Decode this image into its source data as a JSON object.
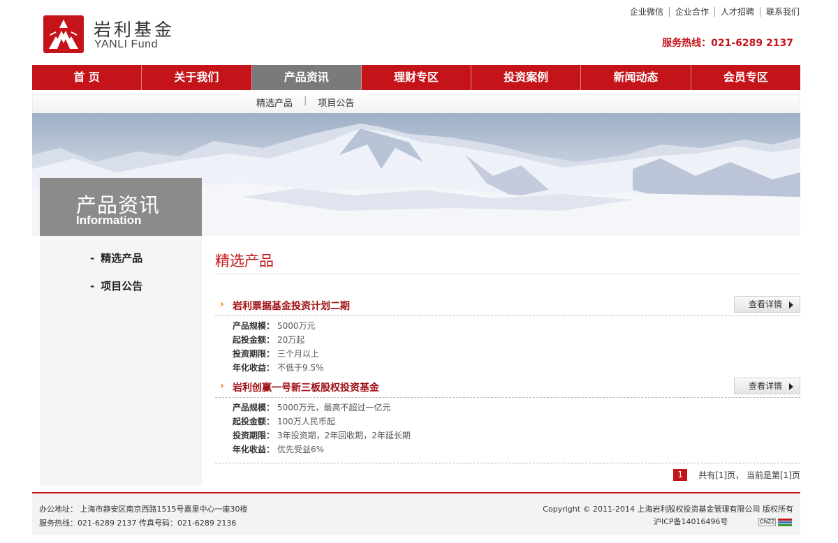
{
  "brand": {
    "name_cn": "岩利基金",
    "name_en": "YANLI Fund",
    "accent_color": "#c4141a"
  },
  "toplinks": [
    "企业微信",
    "企业合作",
    "人才招聘",
    "联系我们"
  ],
  "hotline": "服务热线：021-6289 2137",
  "nav": {
    "items": [
      "首 页",
      "关于我们",
      "产品资讯",
      "理财专区",
      "投资案例",
      "新闻动态",
      "会员专区"
    ],
    "active_index": 2
  },
  "subnav": {
    "items": [
      "精选产品",
      "项目公告"
    ],
    "separator": "|"
  },
  "banner": {
    "title": "产品资讯",
    "subtitle": "Information"
  },
  "sidebar": {
    "items": [
      {
        "dash": "-",
        "label": "精选产品"
      },
      {
        "dash": "-",
        "label": "项目公告"
      }
    ]
  },
  "content": {
    "title": "精选产品",
    "products": [
      {
        "arrow": "›",
        "name": "岩利票据基金投资计划二期",
        "detail_label": "查看详情",
        "specs": [
          {
            "label": "产品规模：",
            "value": "5000万元"
          },
          {
            "label": "起投金额：",
            "value": "20万起"
          },
          {
            "label": "投资期限：",
            "value": "三个月以上"
          },
          {
            "label": "年化收益：",
            "value": "不低于9.5%"
          }
        ]
      },
      {
        "arrow": "›",
        "name": "岩利创赢一号新三板股权投资基金",
        "detail_label": "查看详情",
        "specs": [
          {
            "label": "产品规模：",
            "value": "5000万元，最高不超过一亿元"
          },
          {
            "label": "起投金额：",
            "value": "100万人民币起"
          },
          {
            "label": "投资期限：",
            "value": "3年投资期，2年回收期，2年延长期"
          },
          {
            "label": "年化收益：",
            "value": "优先受益6%"
          }
        ]
      }
    ],
    "pager": {
      "current": "1",
      "summary": "共有[1]页， 当前是第[1]页"
    }
  },
  "footer": {
    "address": "办公地址：  上海市静安区南京西路1515号嘉里中心一座30楼",
    "contact": "服务热线：021-6289 2137 传真号码：021-6289 2136",
    "copyright": "Copyright © 2011-2014 上海岩利股权投资基金管理有限公司 版权所有",
    "icp": "沪ICP备14016496号",
    "cnzz": "CNZZ"
  }
}
